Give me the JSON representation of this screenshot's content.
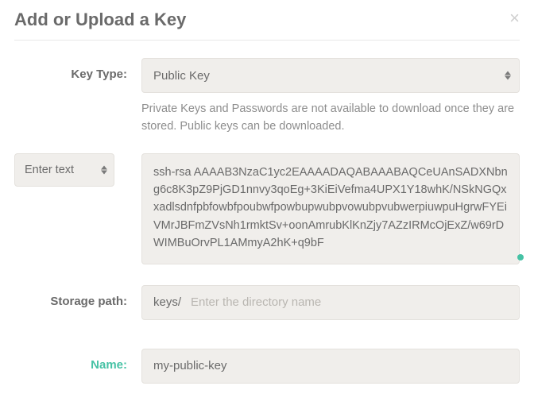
{
  "modal": {
    "title": "Add or Upload a Key"
  },
  "keyType": {
    "label": "Key Type:",
    "selected": "Public Key",
    "help": "Private Keys and Passwords are not available to download once they are stored. Public keys can be downloaded."
  },
  "inputMode": {
    "selected": "Enter text"
  },
  "keyValue": {
    "text": "ssh-rsa AAAAB3NzaC1yc2EAAAADAQABAAABAQCeUAnSADXNbng6c8K3pZ9PjGD1nnvy3qoEg+3KiEiVefma4UPX1Y18whK/NSkNGQxxadlsdnfpbfowbfpoubwfpowbupwubpvowubpvubwerpiuwpuHgrwFYEiVMrJBFmZVsNh1rmktSv+oonAmrubKlKnZjy7AZzIRMcOjExZ/w69rDWIMBuOrvPL1AMmyA2hK+q9bF"
  },
  "storagePath": {
    "label": "Storage path:",
    "prefix": "keys/",
    "placeholder": "Enter the directory name",
    "value": ""
  },
  "name": {
    "label": "Name:",
    "value": "my-public-key"
  }
}
